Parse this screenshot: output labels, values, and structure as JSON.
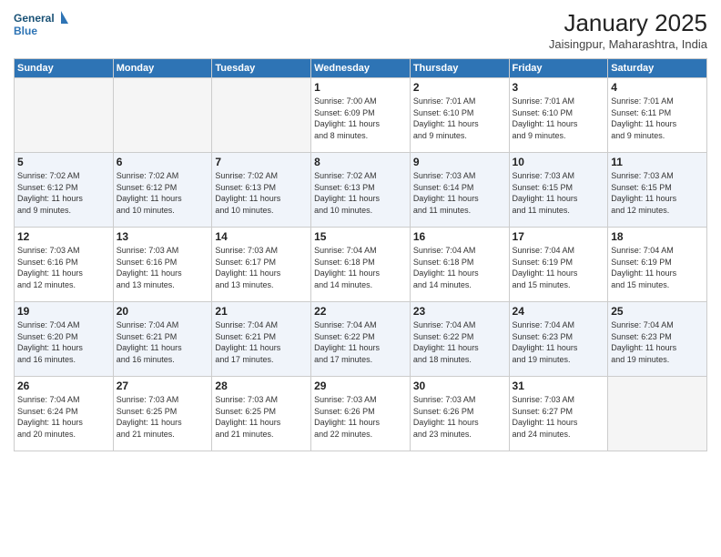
{
  "logo": {
    "line1": "General",
    "line2": "Blue"
  },
  "title": "January 2025",
  "subtitle": "Jaisingpur, Maharashtra, India",
  "days_header": [
    "Sunday",
    "Monday",
    "Tuesday",
    "Wednesday",
    "Thursday",
    "Friday",
    "Saturday"
  ],
  "weeks": [
    [
      {
        "num": "",
        "info": ""
      },
      {
        "num": "",
        "info": ""
      },
      {
        "num": "",
        "info": ""
      },
      {
        "num": "1",
        "info": "Sunrise: 7:00 AM\nSunset: 6:09 PM\nDaylight: 11 hours\nand 8 minutes."
      },
      {
        "num": "2",
        "info": "Sunrise: 7:01 AM\nSunset: 6:10 PM\nDaylight: 11 hours\nand 9 minutes."
      },
      {
        "num": "3",
        "info": "Sunrise: 7:01 AM\nSunset: 6:10 PM\nDaylight: 11 hours\nand 9 minutes."
      },
      {
        "num": "4",
        "info": "Sunrise: 7:01 AM\nSunset: 6:11 PM\nDaylight: 11 hours\nand 9 minutes."
      }
    ],
    [
      {
        "num": "5",
        "info": "Sunrise: 7:02 AM\nSunset: 6:12 PM\nDaylight: 11 hours\nand 9 minutes."
      },
      {
        "num": "6",
        "info": "Sunrise: 7:02 AM\nSunset: 6:12 PM\nDaylight: 11 hours\nand 10 minutes."
      },
      {
        "num": "7",
        "info": "Sunrise: 7:02 AM\nSunset: 6:13 PM\nDaylight: 11 hours\nand 10 minutes."
      },
      {
        "num": "8",
        "info": "Sunrise: 7:02 AM\nSunset: 6:13 PM\nDaylight: 11 hours\nand 10 minutes."
      },
      {
        "num": "9",
        "info": "Sunrise: 7:03 AM\nSunset: 6:14 PM\nDaylight: 11 hours\nand 11 minutes."
      },
      {
        "num": "10",
        "info": "Sunrise: 7:03 AM\nSunset: 6:15 PM\nDaylight: 11 hours\nand 11 minutes."
      },
      {
        "num": "11",
        "info": "Sunrise: 7:03 AM\nSunset: 6:15 PM\nDaylight: 11 hours\nand 12 minutes."
      }
    ],
    [
      {
        "num": "12",
        "info": "Sunrise: 7:03 AM\nSunset: 6:16 PM\nDaylight: 11 hours\nand 12 minutes."
      },
      {
        "num": "13",
        "info": "Sunrise: 7:03 AM\nSunset: 6:16 PM\nDaylight: 11 hours\nand 13 minutes."
      },
      {
        "num": "14",
        "info": "Sunrise: 7:03 AM\nSunset: 6:17 PM\nDaylight: 11 hours\nand 13 minutes."
      },
      {
        "num": "15",
        "info": "Sunrise: 7:04 AM\nSunset: 6:18 PM\nDaylight: 11 hours\nand 14 minutes."
      },
      {
        "num": "16",
        "info": "Sunrise: 7:04 AM\nSunset: 6:18 PM\nDaylight: 11 hours\nand 14 minutes."
      },
      {
        "num": "17",
        "info": "Sunrise: 7:04 AM\nSunset: 6:19 PM\nDaylight: 11 hours\nand 15 minutes."
      },
      {
        "num": "18",
        "info": "Sunrise: 7:04 AM\nSunset: 6:19 PM\nDaylight: 11 hours\nand 15 minutes."
      }
    ],
    [
      {
        "num": "19",
        "info": "Sunrise: 7:04 AM\nSunset: 6:20 PM\nDaylight: 11 hours\nand 16 minutes."
      },
      {
        "num": "20",
        "info": "Sunrise: 7:04 AM\nSunset: 6:21 PM\nDaylight: 11 hours\nand 16 minutes."
      },
      {
        "num": "21",
        "info": "Sunrise: 7:04 AM\nSunset: 6:21 PM\nDaylight: 11 hours\nand 17 minutes."
      },
      {
        "num": "22",
        "info": "Sunrise: 7:04 AM\nSunset: 6:22 PM\nDaylight: 11 hours\nand 17 minutes."
      },
      {
        "num": "23",
        "info": "Sunrise: 7:04 AM\nSunset: 6:22 PM\nDaylight: 11 hours\nand 18 minutes."
      },
      {
        "num": "24",
        "info": "Sunrise: 7:04 AM\nSunset: 6:23 PM\nDaylight: 11 hours\nand 19 minutes."
      },
      {
        "num": "25",
        "info": "Sunrise: 7:04 AM\nSunset: 6:23 PM\nDaylight: 11 hours\nand 19 minutes."
      }
    ],
    [
      {
        "num": "26",
        "info": "Sunrise: 7:04 AM\nSunset: 6:24 PM\nDaylight: 11 hours\nand 20 minutes."
      },
      {
        "num": "27",
        "info": "Sunrise: 7:03 AM\nSunset: 6:25 PM\nDaylight: 11 hours\nand 21 minutes."
      },
      {
        "num": "28",
        "info": "Sunrise: 7:03 AM\nSunset: 6:25 PM\nDaylight: 11 hours\nand 21 minutes."
      },
      {
        "num": "29",
        "info": "Sunrise: 7:03 AM\nSunset: 6:26 PM\nDaylight: 11 hours\nand 22 minutes."
      },
      {
        "num": "30",
        "info": "Sunrise: 7:03 AM\nSunset: 6:26 PM\nDaylight: 11 hours\nand 23 minutes."
      },
      {
        "num": "31",
        "info": "Sunrise: 7:03 AM\nSunset: 6:27 PM\nDaylight: 11 hours\nand 24 minutes."
      },
      {
        "num": "",
        "info": ""
      }
    ]
  ]
}
